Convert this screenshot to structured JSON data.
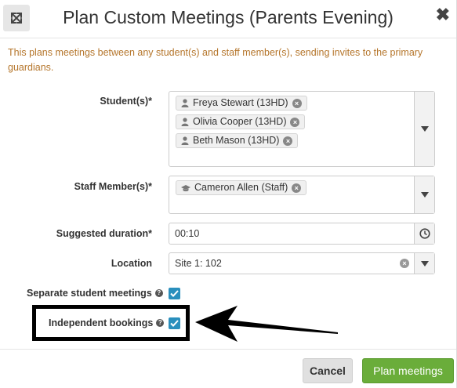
{
  "header": {
    "title": "Plan Custom Meetings (Parents Evening)",
    "close_glyph": "✖",
    "expand_icon": "expand-arrows-icon"
  },
  "info_text": "This plans meetings between any student(s) and staff member(s), sending invites to the primary guardians.",
  "students": {
    "label": "Student(s)*",
    "tags": [
      "Freya Stewart (13HD)",
      "Olivia Cooper (13HD)",
      "Beth Mason (13HD)"
    ],
    "tag_icon": "user-icon"
  },
  "staff": {
    "label": "Staff Member(s)*",
    "tags": [
      "Cameron Allen (Staff)"
    ],
    "tag_icon": "graduation-cap-icon"
  },
  "duration": {
    "label": "Suggested duration*",
    "value": "00:10",
    "icon": "clock-icon"
  },
  "location": {
    "label": "Location",
    "value": "Site 1: 102"
  },
  "separate_meetings": {
    "label": "Separate student meetings",
    "checked": true
  },
  "independent_bookings": {
    "label": "Independent bookings",
    "checked": true
  },
  "buttons": {
    "cancel": "Cancel",
    "plan": "Plan meetings"
  },
  "colors": {
    "info_text": "#b5762c",
    "checkbox": "#2a8fbd",
    "primary_button": "#6aad3a",
    "annotation": "#000000"
  }
}
